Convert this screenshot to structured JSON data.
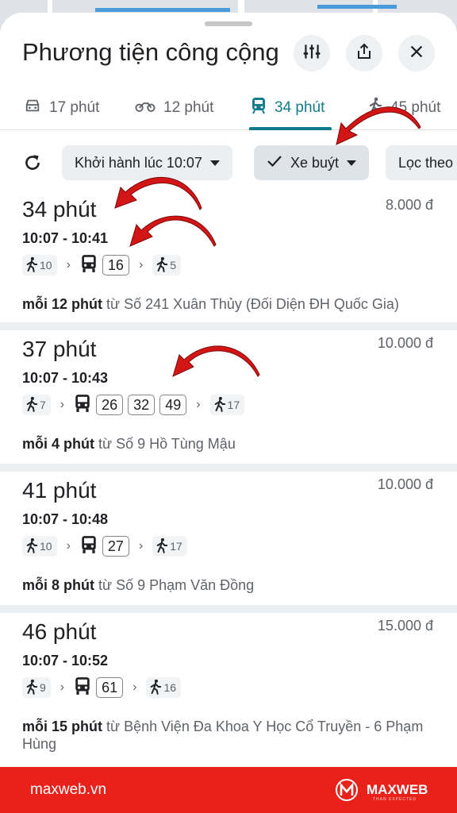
{
  "header": {
    "title": "Phương tiện công cộng",
    "filter_icon": "tune-icon",
    "share_icon": "share-icon",
    "close_icon": "close-icon"
  },
  "tabs": [
    {
      "mode": "car",
      "label": "17 phút"
    },
    {
      "mode": "motorbike",
      "label": "12 phút"
    },
    {
      "mode": "transit",
      "label": "34 phút",
      "active": true
    },
    {
      "mode": "walk",
      "label": "45 phút"
    }
  ],
  "filters": {
    "departure": "Khởi hành lúc 10:07",
    "bus": "Xe buýt",
    "more": "Lọc theo"
  },
  "routes": [
    {
      "duration": "34 phút",
      "price": "8.000 đ",
      "time": "10:07 - 10:41",
      "walk_start": "10",
      "buses": [
        "16"
      ],
      "walk_end": "5",
      "freq_bold": "mỗi 12 phút",
      "freq_rest": "từ Số 241 Xuân Thủy (Đối Diện ĐH Quốc Gia)"
    },
    {
      "duration": "37 phút",
      "price": "10.000 đ",
      "time": "10:07 - 10:43",
      "walk_start": "7",
      "buses": [
        "26",
        "32",
        "49"
      ],
      "walk_end": "17",
      "freq_bold": "mỗi 4 phút",
      "freq_rest": "từ Số 9 Hồ Tùng Mậu"
    },
    {
      "duration": "41 phút",
      "price": "10.000 đ",
      "time": "10:07 - 10:48",
      "walk_start": "10",
      "buses": [
        "27"
      ],
      "walk_end": "17",
      "freq_bold": "mỗi 8 phút",
      "freq_rest": "từ Số 9 Phạm Văn Đồng"
    },
    {
      "duration": "46 phút",
      "price": "15.000 đ",
      "time": "10:07 - 10:52",
      "walk_start": "9",
      "buses": [
        "61"
      ],
      "walk_end": "16",
      "freq_bold": "mỗi 15 phút",
      "freq_rest": "từ Bệnh Viện Đa Khoa Y Học Cổ Truyền - 6 Phạm Hùng"
    }
  ],
  "footer": {
    "site": "maxweb.vn",
    "brand": "MAXWEB",
    "tagline": "THAN EXPECTED"
  },
  "colors": {
    "accent": "#127c8c",
    "arrow": "#d41515",
    "footer": "#e8221a"
  }
}
